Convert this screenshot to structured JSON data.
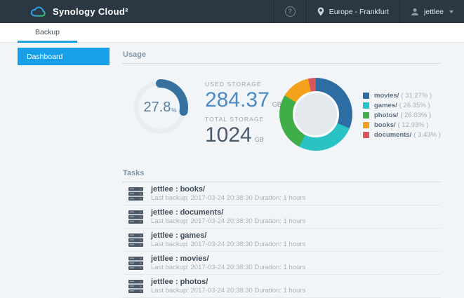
{
  "topbar": {
    "app_title": "Synology Cloud²",
    "help_icon": "question-mark",
    "help_glyph": "?",
    "region": "Europe - Frankfurt",
    "user": "jettlee"
  },
  "tabs": {
    "backup_label": "Backup"
  },
  "sidebar": {
    "dashboard_label": "Dashboard"
  },
  "usage": {
    "section_title": "Usage",
    "used_label": "USED STORAGE",
    "used_value": "284.37",
    "used_unit": "GB",
    "total_label": "TOTAL STORAGE",
    "total_value": "1024",
    "total_unit": "GB",
    "percent_value": "27.8",
    "percent_unit": "%"
  },
  "chart_data": [
    {
      "type": "donut-gauge",
      "title": "Used storage percentage",
      "value": 27.8,
      "max": 100,
      "label": "27.8 %",
      "color": "#36719f",
      "track_color": "#e8edf2"
    },
    {
      "type": "pie",
      "title": "Storage breakdown by folder",
      "categories": [
        "movies/",
        "games/",
        "photos/",
        "books/",
        "documents/"
      ],
      "values": [
        31.27,
        26.35,
        26.03,
        12.93,
        3.43
      ],
      "colors": [
        "#2d6da3",
        "#29c2c5",
        "#3fae49",
        "#f5a11c",
        "#d9575c"
      ],
      "donut_hole": true,
      "legend_position": "right",
      "legend": [
        {
          "name": "movies/",
          "pct_label": "( 31.27% )",
          "color": "#2d6da3"
        },
        {
          "name": "games/",
          "pct_label": "( 26.35% )",
          "color": "#29c2c5"
        },
        {
          "name": "photos/",
          "pct_label": "( 26.03% )",
          "color": "#3fae49"
        },
        {
          "name": "books/",
          "pct_label": "( 12.93% )",
          "color": "#f5a11c"
        },
        {
          "name": "documents/",
          "pct_label": "( 3.43% )",
          "color": "#d9575c"
        }
      ]
    }
  ],
  "tasks": {
    "section_title": "Tasks",
    "items": [
      {
        "title": "jettlee : books/",
        "subtitle": "Last backup: 2017-03-24 20:38:30 Duration: 1 hours"
      },
      {
        "title": "jettlee : documents/",
        "subtitle": "Last backup: 2017-03-24 20:38:30 Duration: 1 hours"
      },
      {
        "title": "jettlee : games/",
        "subtitle": "Last backup: 2017-03-24 20:38:30 Duration: 1 hours"
      },
      {
        "title": "jettlee : movies/",
        "subtitle": "Last backup: 2017-03-24 20:38:30 Duration: 1 hours"
      },
      {
        "title": "jettlee : photos/",
        "subtitle": "Last backup: 2017-03-24 20:38:30 Duration: 1 hours"
      }
    ]
  },
  "colors": {
    "topbar_bg": "#2b3743",
    "content_bg": "#f1f5f8",
    "accent_blue": "#17a0e8",
    "tab_underline": "#1e9fe2",
    "used_value": "#4d8ac4",
    "total_value": "#4c5b6b"
  }
}
